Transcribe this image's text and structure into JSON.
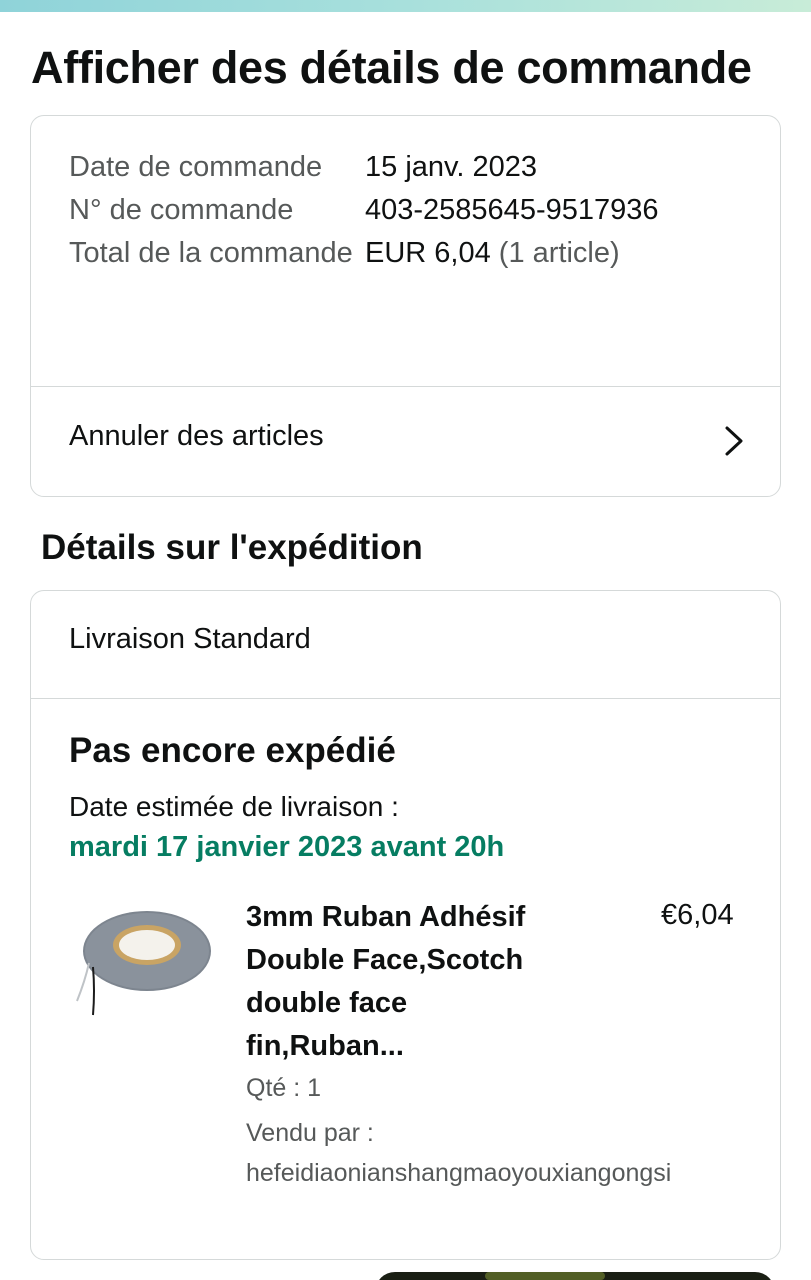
{
  "page": {
    "title": "Afficher des détails de commande"
  },
  "summary": {
    "date_label": "Date de commande",
    "date_value": "15 janv. 2023",
    "order_no_label": "N° de commande",
    "order_no_value": "403-2585645-9517936",
    "total_label": "Total de la commande",
    "total_value": "EUR 6,04",
    "total_items": "(1 article)",
    "cancel_label": "Annuler des articles"
  },
  "shipping": {
    "section_title": "Détails sur l'expédition",
    "method": "Livraison Standard",
    "status": "Pas encore expédié",
    "estimated_label": "Date estimée de livraison :",
    "estimated_date": "mardi 17 janvier 2023 avant 20h",
    "item": {
      "title": "3mm Ruban Adhésif Double Face,Scotch double face fin,Ruban...",
      "price": "€6,04",
      "quantity": "Qté : 1",
      "sold_by_label": "Vendu par :",
      "seller": "hefeidiaonianshangmaoyouxiangongsi"
    }
  },
  "colors": {
    "delivery_date": "#067d62",
    "muted_text": "#565959",
    "border": "#d5d9d9"
  },
  "icons": {
    "cancel_chevron": "chevron-right-icon",
    "product_image": "tape-roll-image"
  }
}
